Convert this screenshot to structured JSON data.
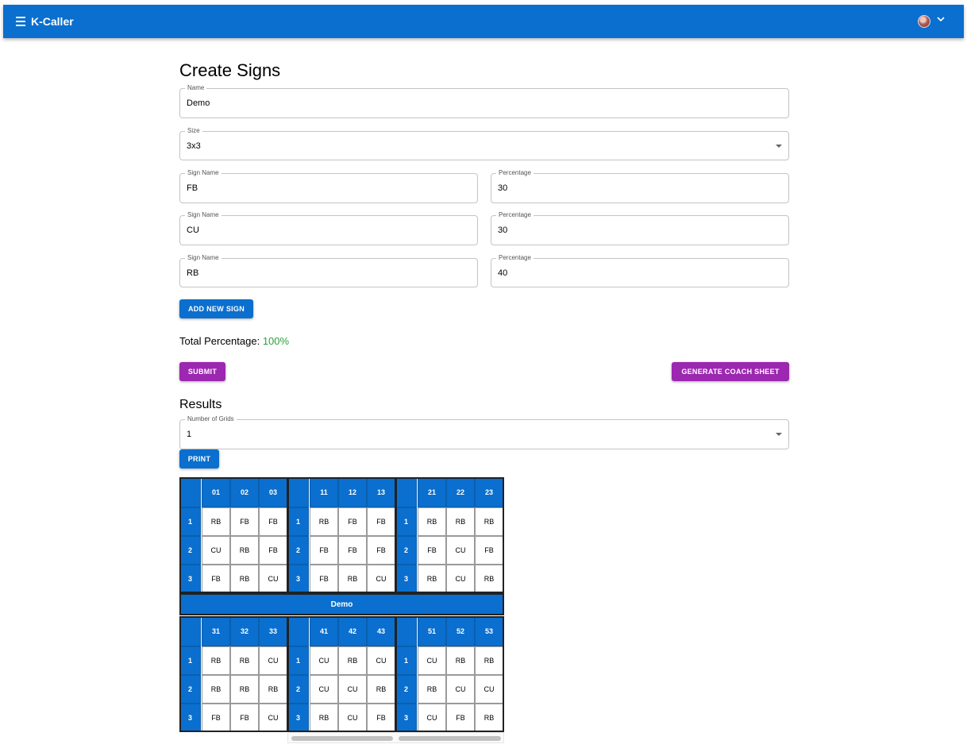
{
  "app": {
    "title": "K-Caller"
  },
  "colors": {
    "primary": "#0a6fce",
    "secondary": "#9c27b0",
    "success": "#2e9e3e"
  },
  "icons": {
    "menu": "menu-icon",
    "avatar": "avatar",
    "chevron": "chevron-down-icon",
    "dropdown": "dropdown-arrow-icon"
  },
  "form": {
    "title": "Create Signs",
    "name": {
      "label": "Name",
      "value": "Demo"
    },
    "size": {
      "label": "Size",
      "value": "3x3"
    },
    "signs": [
      {
        "name_label": "Sign Name",
        "name": "FB",
        "pct_label": "Percentage",
        "pct": "30"
      },
      {
        "name_label": "Sign Name",
        "name": "CU",
        "pct_label": "Percentage",
        "pct": "30"
      },
      {
        "name_label": "Sign Name",
        "name": "RB",
        "pct_label": "Percentage",
        "pct": "40"
      }
    ],
    "add_sign_label": "ADD NEW SIGN",
    "total_label": "Total Percentage:",
    "total_value": "100%",
    "submit_label": "SUBMIT",
    "coach_sheet_label": "GENERATE COACH SHEET"
  },
  "results": {
    "title": "Results",
    "grids": {
      "label": "Number of Grids",
      "value": "1"
    },
    "print_label": "PRINT",
    "grid_name": "Demo",
    "blocks": [
      {
        "cols": [
          "01",
          "02",
          "03"
        ],
        "rows": [
          "1",
          "2",
          "3"
        ],
        "cells": [
          [
            "RB",
            "FB",
            "FB"
          ],
          [
            "CU",
            "RB",
            "FB"
          ],
          [
            "FB",
            "RB",
            "CU"
          ]
        ]
      },
      {
        "cols": [
          "11",
          "12",
          "13"
        ],
        "rows": [
          "1",
          "2",
          "3"
        ],
        "cells": [
          [
            "RB",
            "FB",
            "FB"
          ],
          [
            "FB",
            "FB",
            "FB"
          ],
          [
            "FB",
            "RB",
            "CU"
          ]
        ]
      },
      {
        "cols": [
          "21",
          "22",
          "23"
        ],
        "rows": [
          "1",
          "2",
          "3"
        ],
        "cells": [
          [
            "RB",
            "RB",
            "RB"
          ],
          [
            "FB",
            "CU",
            "FB"
          ],
          [
            "RB",
            "CU",
            "RB"
          ]
        ]
      },
      {
        "cols": [
          "31",
          "32",
          "33"
        ],
        "rows": [
          "1",
          "2",
          "3"
        ],
        "cells": [
          [
            "RB",
            "RB",
            "CU"
          ],
          [
            "RB",
            "RB",
            "RB"
          ],
          [
            "FB",
            "FB",
            "CU"
          ]
        ]
      },
      {
        "cols": [
          "41",
          "42",
          "43"
        ],
        "rows": [
          "1",
          "2",
          "3"
        ],
        "cells": [
          [
            "CU",
            "RB",
            "CU"
          ],
          [
            "CU",
            "CU",
            "RB"
          ],
          [
            "RB",
            "CU",
            "FB"
          ]
        ]
      },
      {
        "cols": [
          "51",
          "52",
          "53"
        ],
        "rows": [
          "1",
          "2",
          "3"
        ],
        "cells": [
          [
            "CU",
            "RB",
            "RB"
          ],
          [
            "RB",
            "CU",
            "CU"
          ],
          [
            "CU",
            "FB",
            "RB"
          ]
        ]
      }
    ]
  }
}
